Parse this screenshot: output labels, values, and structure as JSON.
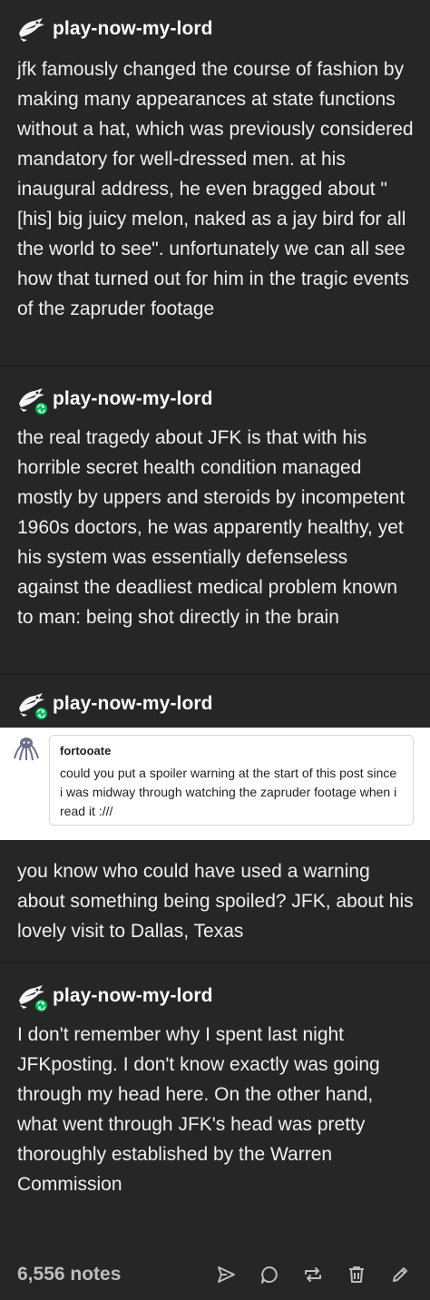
{
  "posts": [
    {
      "username": "play-now-my-lord",
      "text": "jfk famously changed the course of fashion by making many appearances at state functions without a hat, which was previously considered mandatory for well-dressed men. at his inaugural address, he even bragged about \"[his] big juicy melon, naked as a jay bird for all the world to see\". unfortunately we can all see how that turned out for him in the tragic events of the zapruder footage"
    },
    {
      "username": "play-now-my-lord",
      "text": "the real tragedy about JFK is that with his horrible secret health condition managed mostly by uppers and steroids by incompetent 1960s doctors, he was apparently healthy, yet his system was essentially defenseless against the deadliest medical problem known to man: being shot directly in the brain"
    },
    {
      "username": "play-now-my-lord",
      "ask": {
        "asker": "fortooate",
        "question": "could you put a spoiler warning at the start of this post since i was midway through watching the zapruder footage when i read it :///"
      },
      "text": "you know who could have used a warning about something being spoiled? JFK, about his lovely visit to Dallas, Texas"
    },
    {
      "username": "play-now-my-lord",
      "text": "I don't remember why I spent last night JFKposting. I don't know exactly was going through my head here. On the other hand, what went through JFK's head was pretty thoroughly established by the Warren Commission"
    }
  ],
  "footer": {
    "notes": "6,556 notes",
    "actions": [
      "send-icon",
      "reply-icon",
      "reblog-icon",
      "delete-icon",
      "edit-icon"
    ]
  },
  "colors": {
    "background": "#262626",
    "separator": "#1d1d1d",
    "reblog_badge": "#00b85c",
    "ask_background": "#ffffff"
  }
}
